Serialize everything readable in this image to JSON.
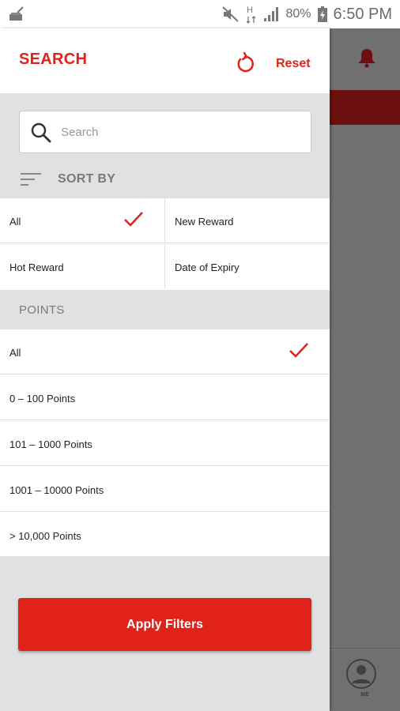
{
  "status_bar": {
    "battery": "80%",
    "time": "6:50 PM",
    "network": "H"
  },
  "drawer": {
    "title": "SEARCH",
    "reset_label": "Reset",
    "search_placeholder": "Search",
    "sort_by_label": "SORT BY",
    "sort_options": [
      {
        "label": "All",
        "selected": true
      },
      {
        "label": "New Reward",
        "selected": false
      },
      {
        "label": "Hot Reward",
        "selected": false
      },
      {
        "label": "Date of Expiry",
        "selected": false
      }
    ],
    "points_label": "POINTS",
    "points_options": [
      {
        "label": "All",
        "selected": true
      },
      {
        "label": "0 – 100 Points",
        "selected": false
      },
      {
        "label": "101 – 1000 Points",
        "selected": false
      },
      {
        "label": "1001 – 10000 Points",
        "selected": false
      },
      {
        "label": "> 10,000 Points",
        "selected": false
      }
    ],
    "apply_label": "Apply Filters"
  },
  "background_app": {
    "tab_label": "ME"
  },
  "colors": {
    "accent": "#e0221a",
    "overlay": "#707070",
    "section_bg": "#e1e1e1"
  }
}
